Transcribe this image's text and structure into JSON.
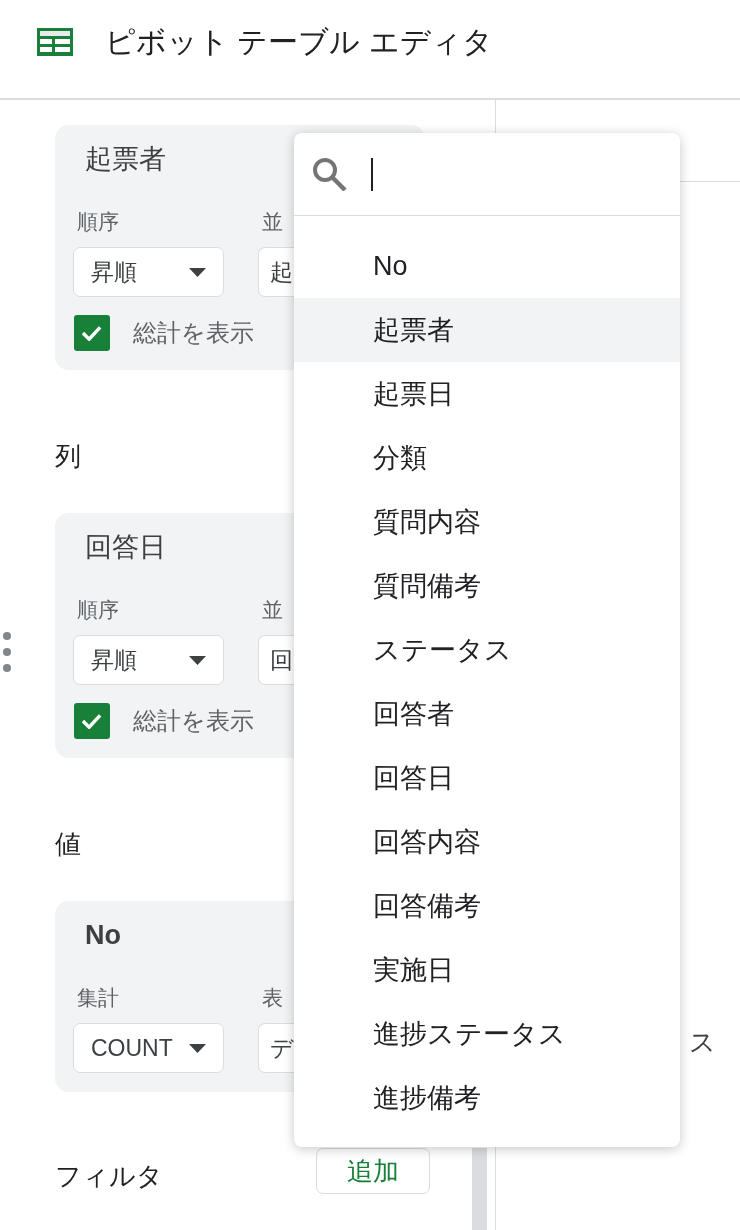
{
  "header": {
    "title": "ピボット テーブル エディタ"
  },
  "sections": [
    {
      "card": {
        "kind": "group",
        "title": "起票者",
        "drag_handle": false,
        "fields": [
          {
            "label": "順序",
            "value": "昇順"
          },
          {
            "label": "並",
            "value": "起"
          }
        ],
        "total": {
          "label": "総計を表示",
          "checked": true
        }
      }
    },
    {
      "heading": "列",
      "card": {
        "kind": "group",
        "title": "回答日",
        "drag_handle": true,
        "fields": [
          {
            "label": "順序",
            "value": "昇順"
          },
          {
            "label": "並",
            "value": "回"
          }
        ],
        "total": {
          "label": "総計を表示",
          "checked": true
        }
      }
    },
    {
      "heading": "値",
      "card": {
        "kind": "value",
        "title": "No",
        "drag_handle": false,
        "fields": [
          {
            "label": "集計",
            "value": "COUNT"
          },
          {
            "label": "表",
            "value": "デ"
          }
        ]
      }
    }
  ],
  "filter": {
    "heading": "フィルタ",
    "button": "追加"
  },
  "right_panel": {
    "text": "ス"
  },
  "dropdown": {
    "search": {
      "focused": true
    },
    "items": [
      {
        "label": "No",
        "selected": false
      },
      {
        "label": "起票者",
        "selected": true
      },
      {
        "label": "起票日",
        "selected": false
      },
      {
        "label": "分類",
        "selected": false
      },
      {
        "label": "質問内容",
        "selected": false
      },
      {
        "label": "質問備考",
        "selected": false
      },
      {
        "label": "ステータス",
        "selected": false
      },
      {
        "label": "回答者",
        "selected": false
      },
      {
        "label": "回答日",
        "selected": false
      },
      {
        "label": "回答内容",
        "selected": false
      },
      {
        "label": "回答備考",
        "selected": false
      },
      {
        "label": "実施日",
        "selected": false
      },
      {
        "label": "進捗ステータス",
        "selected": false
      },
      {
        "label": "進捗備考",
        "selected": false
      }
    ]
  }
}
